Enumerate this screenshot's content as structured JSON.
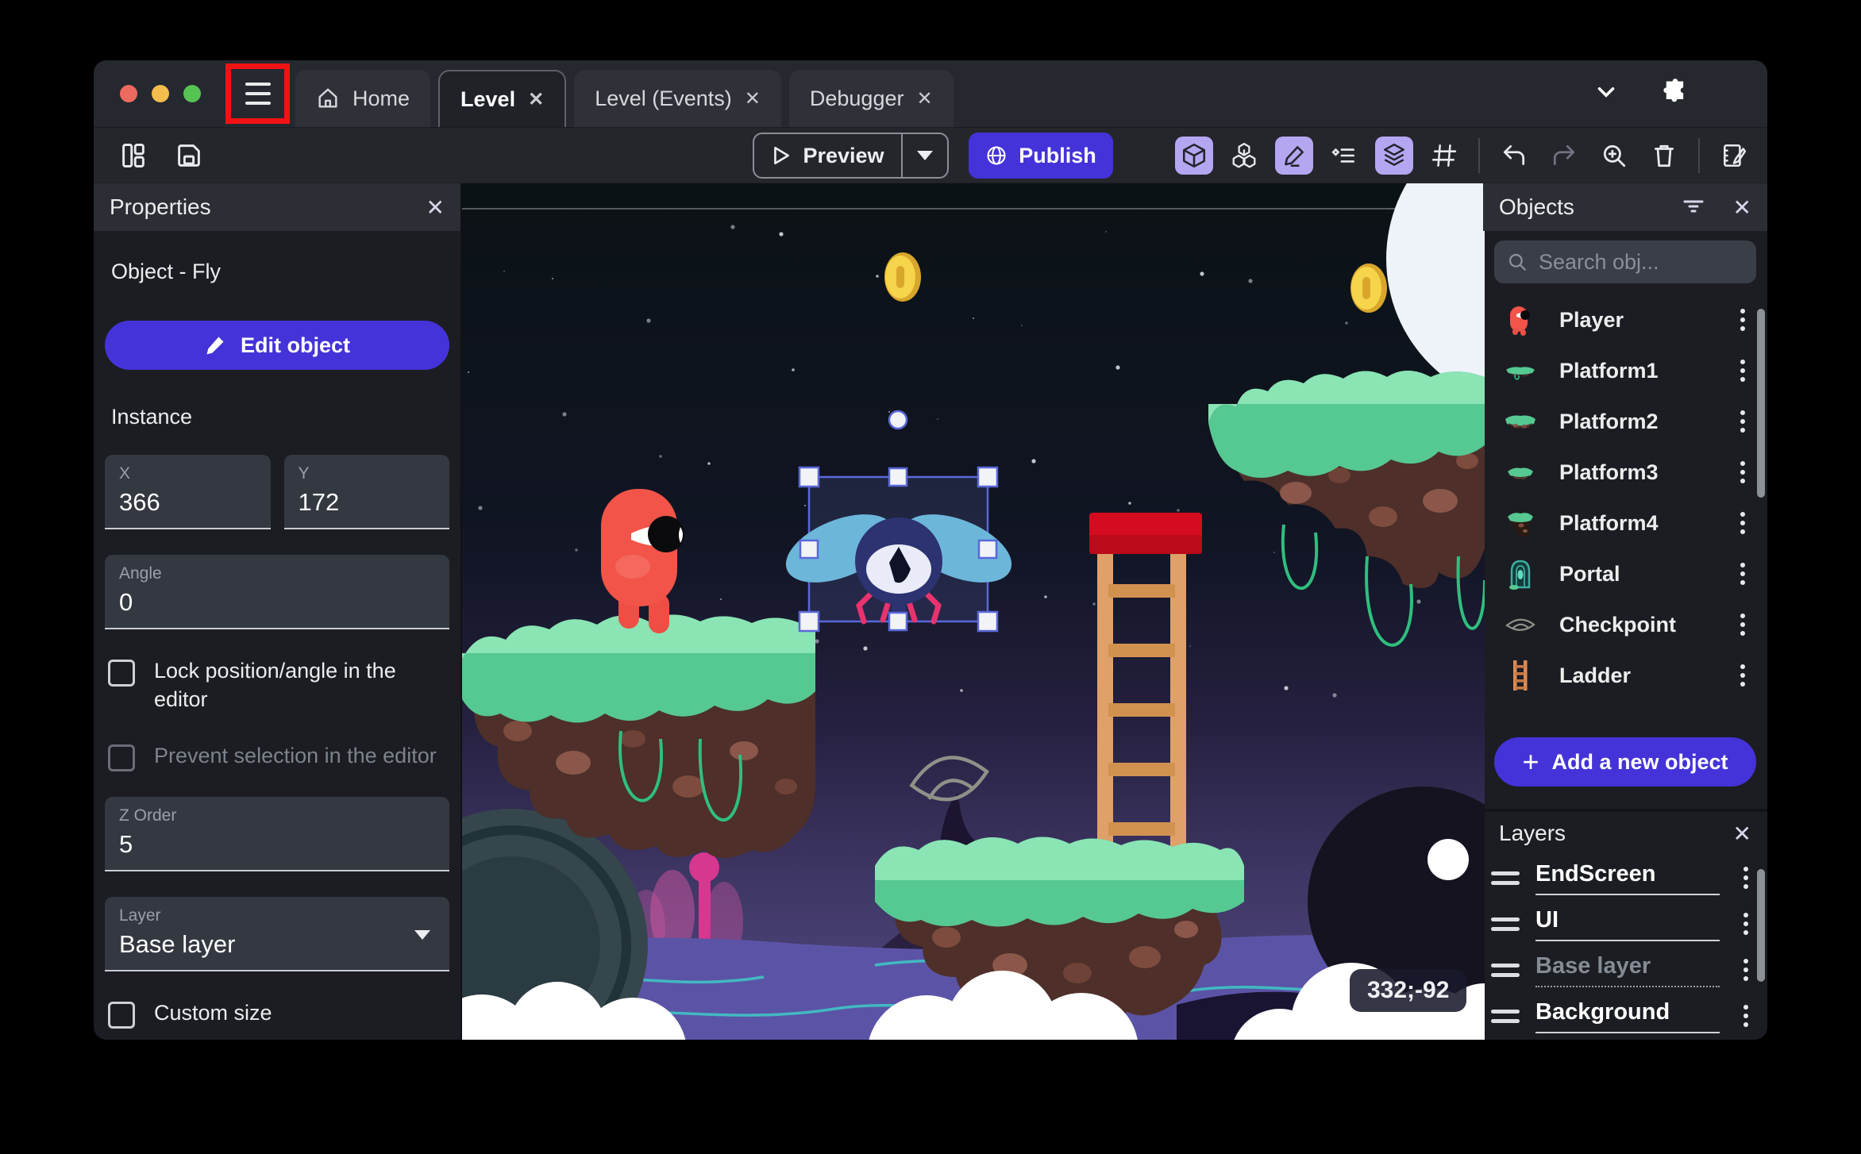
{
  "titlebar": {
    "close_glyph": "✕",
    "tabs": [
      {
        "label": "Home"
      },
      {
        "label": "Level"
      },
      {
        "label": "Level (Events)"
      },
      {
        "label": "Debugger"
      }
    ]
  },
  "toolbar": {
    "preview_label": "Preview",
    "publish_label": "Publish"
  },
  "properties_panel": {
    "title": "Properties",
    "object_heading": "Object  - Fly",
    "edit_object_label": "Edit object",
    "instance_heading": "Instance",
    "x_label": "X",
    "x_value": "366",
    "y_label": "Y",
    "y_value": "172",
    "angle_label": "Angle",
    "angle_value": "0",
    "lock_label": "Lock position/angle in the editor",
    "prevent_label": "Prevent selection in the editor",
    "z_order_label": "Z Order",
    "z_order_value": "5",
    "layer_label": "Layer",
    "layer_value": "Base layer",
    "custom_size_label": "Custom size"
  },
  "objects_panel": {
    "title": "Objects",
    "search_placeholder": "Search obj...",
    "items": [
      {
        "label": "Player"
      },
      {
        "label": "Platform1"
      },
      {
        "label": "Platform2"
      },
      {
        "label": "Platform3"
      },
      {
        "label": "Platform4"
      },
      {
        "label": "Portal"
      },
      {
        "label": "Checkpoint"
      },
      {
        "label": "Ladder"
      }
    ],
    "add_button_label": "Add a new object",
    "plus_glyph": "+"
  },
  "layers_panel": {
    "title": "Layers",
    "items": [
      {
        "label": "EndScreen"
      },
      {
        "label": "UI"
      },
      {
        "label": "Base layer"
      },
      {
        "label": "Background"
      }
    ]
  },
  "canvas": {
    "cursor_coordinates": "332;-92"
  },
  "colors": {
    "accent_purple": "#4433D8",
    "active_toggle_purple": "#B5A6F2",
    "highlight_red": "#F11313",
    "selection_blue": "#5A68D8"
  }
}
